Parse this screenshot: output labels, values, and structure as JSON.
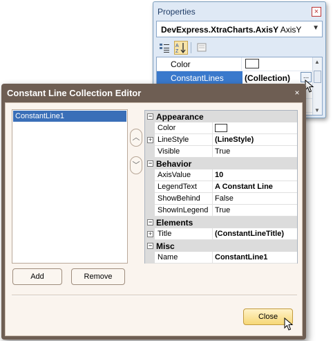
{
  "properties_window": {
    "title": "Properties",
    "close_glyph": "×",
    "object_selector": {
      "type_name": "DevExpress.XtraCharts.AxisY",
      "object_name": "AxisY"
    },
    "rows": [
      {
        "name": "Color",
        "value": ""
      },
      {
        "name": "ConstantLines",
        "value": "(Collection)"
      }
    ],
    "ellipsis_label": "..."
  },
  "editor": {
    "title": "Constant Line Collection Editor",
    "close_glyph": "×",
    "members": [
      "ConstantLine1"
    ],
    "categories": [
      {
        "label": "Appearance",
        "props": [
          {
            "name": "Color",
            "value": "",
            "bold": false,
            "expandable": false,
            "swatch": true
          },
          {
            "name": "LineStyle",
            "value": "(LineStyle)",
            "bold": true,
            "expandable": true
          },
          {
            "name": "Visible",
            "value": "True",
            "bold": false,
            "expandable": false
          }
        ]
      },
      {
        "label": "Behavior",
        "props": [
          {
            "name": "AxisValue",
            "value": "10",
            "bold": true,
            "expandable": false
          },
          {
            "name": "LegendText",
            "value": "A Constant Line",
            "bold": true,
            "expandable": false
          },
          {
            "name": "ShowBehind",
            "value": "False",
            "bold": false,
            "expandable": false
          },
          {
            "name": "ShowInLegend",
            "value": "True",
            "bold": false,
            "expandable": false
          }
        ]
      },
      {
        "label": "Elements",
        "props": [
          {
            "name": "Title",
            "value": "(ConstantLineTitle)",
            "bold": true,
            "expandable": true
          }
        ]
      },
      {
        "label": "Misc",
        "props": [
          {
            "name": "Name",
            "value": "ConstantLine1",
            "bold": true,
            "expandable": false
          }
        ]
      }
    ],
    "buttons": {
      "add": "Add",
      "remove": "Remove",
      "close": "Close"
    }
  },
  "colors": {
    "selection": "#3a79cc",
    "dialog_frame": "#6e5e53",
    "close_button": "#f6d776"
  }
}
